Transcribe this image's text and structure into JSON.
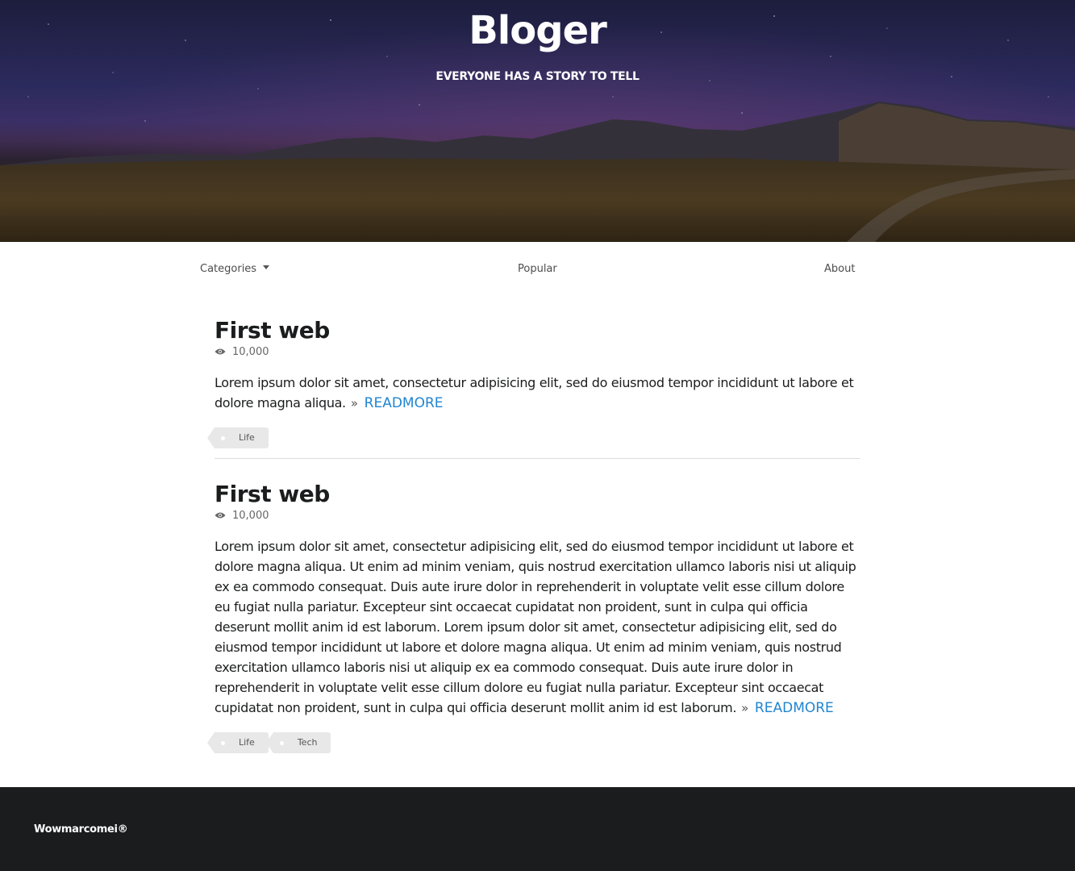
{
  "hero": {
    "title": "Bloger",
    "subtitle": "EVERYONE HAS A STORY TO TELL"
  },
  "nav": {
    "categories": "Categories",
    "popular": "Popular",
    "about": "About"
  },
  "posts": [
    {
      "title": "First web",
      "views": "10,000",
      "body": "Lorem ipsum dolor sit amet, consectetur adipisicing elit, sed do eiusmod tempor incididunt ut labore et dolore magna aliqua.",
      "readmore": "READMORE",
      "tags": [
        "Life"
      ]
    },
    {
      "title": "First web",
      "views": "10,000",
      "body": "Lorem ipsum dolor sit amet, consectetur adipisicing elit, sed do eiusmod tempor incididunt ut labore et dolore magna aliqua. Ut enim ad minim veniam, quis nostrud exercitation ullamco laboris nisi ut aliquip ex ea commodo consequat. Duis aute irure dolor in reprehenderit in voluptate velit esse cillum dolore eu fugiat nulla pariatur. Excepteur sint occaecat cupidatat non proident, sunt in culpa qui officia deserunt mollit anim id est laborum. Lorem ipsum dolor sit amet, consectetur adipisicing elit, sed do eiusmod tempor incididunt ut labore et dolore magna aliqua. Ut enim ad minim veniam, quis nostrud exercitation ullamco laboris nisi ut aliquip ex ea commodo consequat. Duis aute irure dolor in reprehenderit in voluptate velit esse cillum dolore eu fugiat nulla pariatur. Excepteur sint occaecat cupidatat non proident, sunt in culpa qui officia deserunt mollit anim id est laborum.",
      "readmore": "READMORE",
      "tags": [
        "Life",
        "Tech"
      ]
    }
  ],
  "footer": {
    "text": "Wowmarcomei®"
  },
  "colors": {
    "accent": "#2185d0",
    "footer_bg": "#1b1c1d"
  },
  "icons": {
    "views": "eye-icon",
    "readmore": "double-chevron-right-icon",
    "categories_caret": "caret-down-icon"
  }
}
